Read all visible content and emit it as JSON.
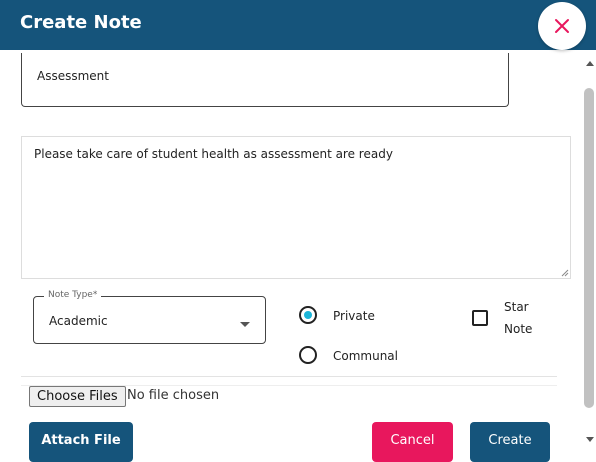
{
  "header": {
    "title": "Create Note"
  },
  "form": {
    "subject_value": "Assessment",
    "description_value": "Please take care of student health as assessment are ready",
    "note_type": {
      "label": "Note Type*",
      "value": "Academic"
    },
    "visibility": {
      "private_label": "Private",
      "communal_label": "Communal",
      "selected": "Private"
    },
    "star_note": {
      "label_line1": "Star",
      "label_line2": "Note",
      "checked": false
    }
  },
  "file": {
    "choose_label": "Choose Files",
    "status": "No file chosen"
  },
  "buttons": {
    "attach": "Attach File",
    "cancel": "Cancel",
    "create": "Create"
  },
  "colors": {
    "primary": "#15547b",
    "cancel": "#e8175d",
    "close_icon": "#e8175d",
    "radio_selected": "#1bb5d8"
  }
}
